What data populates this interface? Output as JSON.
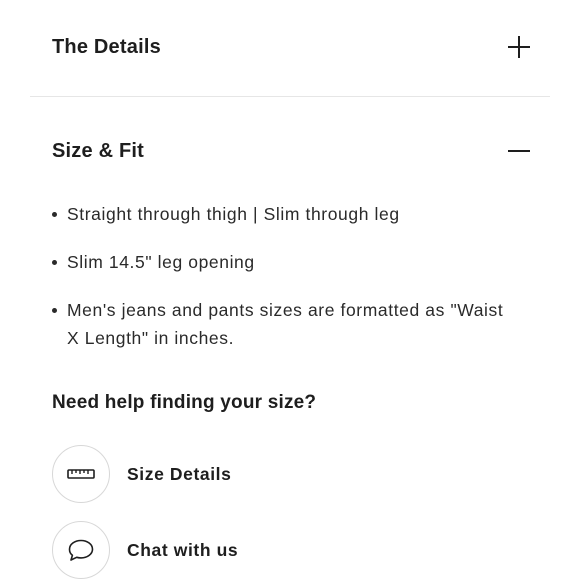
{
  "details": {
    "title": "The Details",
    "state_icon": "plus-icon",
    "expanded": false
  },
  "size_fit": {
    "title": "Size & Fit",
    "state_icon": "minus-icon",
    "expanded": true,
    "items": [
      "Straight through thigh | Slim through leg",
      "Slim 14.5\" leg opening",
      "Men's jeans and pants sizes are formatted as \"Waist X Length\" in inches."
    ]
  },
  "help": {
    "heading": "Need help finding your size?",
    "options": [
      {
        "label": "Size Details",
        "icon": "ruler-icon"
      },
      {
        "label": "Chat with us",
        "icon": "chat-bubble-icon"
      }
    ]
  },
  "colors": {
    "text": "#1e1e1e",
    "body_text": "#2a2a2a",
    "divider": "#e6e6e6",
    "circle_border": "#d8d8d8",
    "background": "#ffffff"
  }
}
